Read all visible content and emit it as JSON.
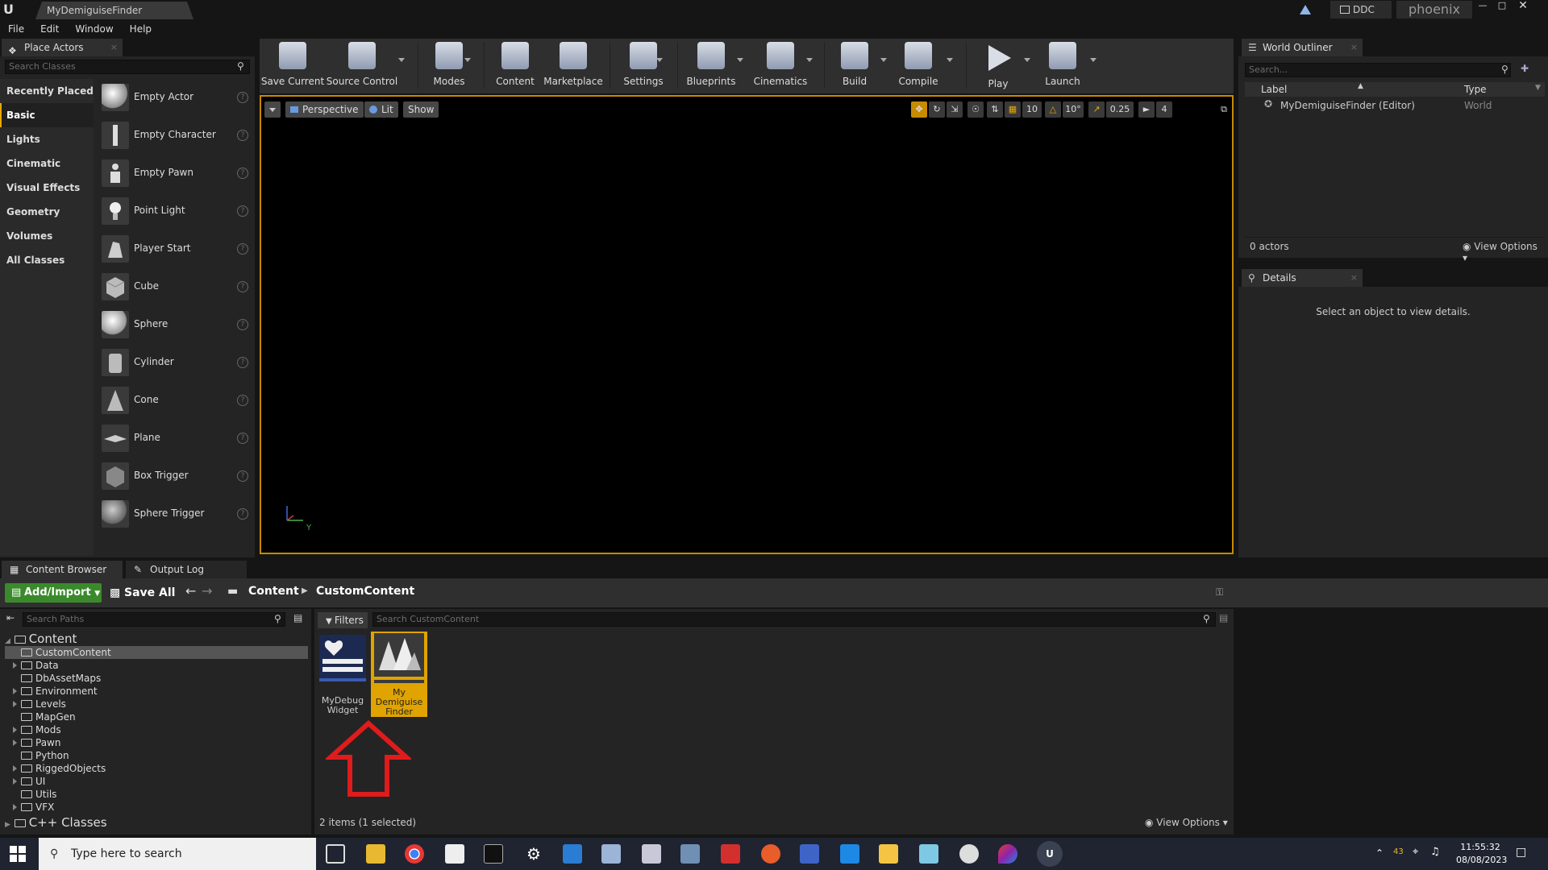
{
  "window": {
    "title": "MyDemiguiseFinder",
    "ddc_label": "DDC",
    "user": "phoenix"
  },
  "menu": [
    "File",
    "Edit",
    "Window",
    "Help"
  ],
  "place_actors": {
    "tab_label": "Place Actors",
    "search_placeholder": "Search Classes",
    "categories": [
      "Recently Placed",
      "Basic",
      "Lights",
      "Cinematic",
      "Visual Effects",
      "Geometry",
      "Volumes",
      "All Classes"
    ],
    "active_category": "Basic",
    "actors": [
      "Empty Actor",
      "Empty Character",
      "Empty Pawn",
      "Point Light",
      "Player Start",
      "Cube",
      "Sphere",
      "Cylinder",
      "Cone",
      "Plane",
      "Box Trigger",
      "Sphere Trigger"
    ]
  },
  "toolbar": [
    "Save Current",
    "Source Control",
    "Modes",
    "Content",
    "Marketplace",
    "Settings",
    "Blueprints",
    "Cinematics",
    "Build",
    "Compile",
    "Play",
    "Launch"
  ],
  "viewport": {
    "perspective": "Perspective",
    "lit": "Lit",
    "show": "Show",
    "grid_snap": "10",
    "rotation_snap": "10°",
    "scale_snap": "0.25",
    "camera_speed": "4",
    "axis_label": "Y"
  },
  "outliner": {
    "tab_label": "World Outliner",
    "search_placeholder": "Search...",
    "col_label": "Label",
    "col_type": "Type",
    "rows": [
      {
        "label": "MyDemiguiseFinder (Editor)",
        "type": "World"
      }
    ],
    "actor_count": "0 actors",
    "view_options": "View Options"
  },
  "details": {
    "tab_label": "Details",
    "empty_text": "Select an object to view details."
  },
  "content_browser": {
    "tabs": [
      "Content Browser",
      "Output Log"
    ],
    "add_import": "Add/Import",
    "save_all": "Save All",
    "breadcrumb": [
      "Content",
      "CustomContent"
    ],
    "search_paths_placeholder": "Search Paths",
    "tree_root": "Content",
    "tree_items": [
      "CustomContent",
      "Data",
      "DbAssetMaps",
      "Environment",
      "Levels",
      "MapGen",
      "Mods",
      "Pawn",
      "Python",
      "RiggedObjects",
      "UI",
      "Utils",
      "VFX"
    ],
    "tree_selected": "CustomContent",
    "cpp_classes": "C++ Classes",
    "filters": "Filters",
    "search_content_placeholder": "Search CustomContent",
    "assets": [
      {
        "label": "MyDebug Widget",
        "selected": false
      },
      {
        "label": "My Demiguise Finder",
        "selected": true
      }
    ],
    "items_count": "2 items (1 selected)",
    "view_options": "View Options"
  },
  "taskbar": {
    "search_placeholder": "Type here to search",
    "tray_badge": "43",
    "time": "11:55:32",
    "date": "08/08/2023"
  },
  "colors": {
    "accent": "#c78a00",
    "add_import_green": "#3a8a2c",
    "annotation_arrow": "#e01b1b"
  }
}
